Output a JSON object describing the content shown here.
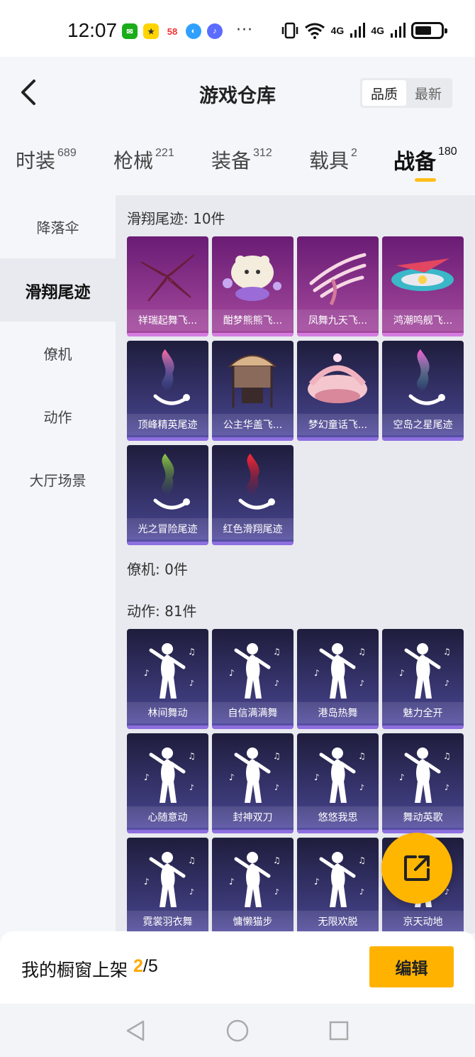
{
  "status_bar": {
    "time": "12:07",
    "more": "···",
    "network_1": "4G",
    "network_2": "4G"
  },
  "header": {
    "title": "游戏仓库",
    "sort_options": [
      "品质",
      "最新"
    ],
    "active_sort": "品质"
  },
  "tabs": [
    {
      "label": "时装",
      "count": "689"
    },
    {
      "label": "枪械",
      "count": "221"
    },
    {
      "label": "装备",
      "count": "312"
    },
    {
      "label": "载具",
      "count": "2"
    },
    {
      "label": "战备",
      "count": "180"
    }
  ],
  "active_tab": "战备",
  "sidebar": {
    "items": [
      "降落伞",
      "滑翔尾迹",
      "僚机",
      "动作",
      "大厅场景"
    ],
    "active": "滑翔尾迹"
  },
  "sections": [
    {
      "title": "滑翔尾迹: 10件",
      "items": [
        {
          "name": "祥瑞起舞飞...",
          "rarity": "purple",
          "icon": "pink-wings-icon"
        },
        {
          "name": "酣梦熊熊飞...",
          "rarity": "purple",
          "icon": "bear-glider-icon"
        },
        {
          "name": "凤舞九天飞...",
          "rarity": "purple",
          "icon": "phoenix-wing-icon"
        },
        {
          "name": "鸿潮鸣舰飞...",
          "rarity": "purple",
          "icon": "starship-icon"
        },
        {
          "name": "顶峰精英尾迹",
          "rarity": "blue",
          "icon": "rainbow-smoke-icon"
        },
        {
          "name": "公主华盖飞...",
          "rarity": "blue",
          "icon": "canopy-glider-icon"
        },
        {
          "name": "梦幻童话飞...",
          "rarity": "blue",
          "icon": "fairytale-bed-icon"
        },
        {
          "name": "空岛之星尾迹",
          "rarity": "blue",
          "icon": "prism-smoke-icon"
        },
        {
          "name": "光之冒险尾迹",
          "rarity": "blue",
          "icon": "green-smoke-icon"
        },
        {
          "name": "红色滑翔尾迹",
          "rarity": "blue",
          "icon": "red-smoke-icon"
        }
      ]
    },
    {
      "title": "僚机: 0件",
      "items": []
    },
    {
      "title": "动作: 81件",
      "items": [
        {
          "name": "林间舞动",
          "rarity": "blue",
          "icon": "dance-pose-icon"
        },
        {
          "name": "自信满满舞",
          "rarity": "blue",
          "icon": "dance-pose-icon"
        },
        {
          "name": "港岛热舞",
          "rarity": "blue",
          "icon": "dance-pose-icon"
        },
        {
          "name": "魅力全开",
          "rarity": "blue",
          "icon": "dance-pose-icon"
        },
        {
          "name": "心随意动",
          "rarity": "blue",
          "icon": "dance-pose-icon"
        },
        {
          "name": "封神双刀",
          "rarity": "blue",
          "icon": "dance-pose-icon"
        },
        {
          "name": "悠悠我思",
          "rarity": "blue",
          "icon": "dance-pose-icon"
        },
        {
          "name": "舞动英歌",
          "rarity": "blue",
          "icon": "dance-pose-icon"
        },
        {
          "name": "霓裳羽衣舞",
          "rarity": "blue",
          "icon": "dance-pose-icon"
        },
        {
          "name": "慵懒猫步",
          "rarity": "blue",
          "icon": "dance-pose-icon"
        },
        {
          "name": "无限欢脱",
          "rarity": "blue",
          "icon": "dance-pose-icon"
        },
        {
          "name": "京天动地",
          "rarity": "blue",
          "icon": "dance-pose-icon"
        }
      ]
    }
  ],
  "bottom_bar": {
    "showcase_label": "我的橱窗上架",
    "showcase_current": "2",
    "showcase_total": "/5",
    "edit_label": "编辑"
  },
  "colors": {
    "accent": "#ffb300",
    "purple_card": "#8a3a8e",
    "blue_card": "#3d3a7a"
  }
}
